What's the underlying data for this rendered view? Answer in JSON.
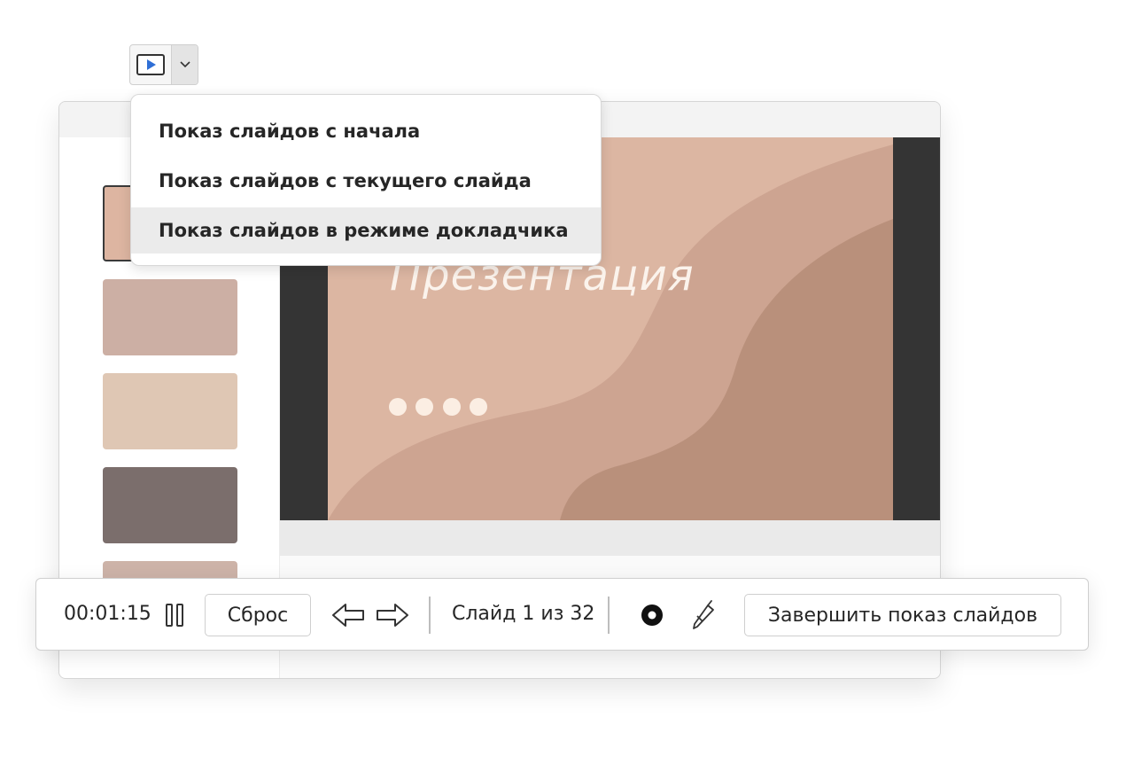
{
  "ribbon": {
    "slideshow_button": {
      "icon": "play-slideshow-icon",
      "dropdown_icon": "chevron-down-icon"
    }
  },
  "slideshow_menu": {
    "items": [
      {
        "label": "Показ слайдов с начала",
        "highlighted": false
      },
      {
        "label": "Показ слайдов с текущего слайда",
        "highlighted": false
      },
      {
        "label": "Показ слайдов в режиме докладчика",
        "highlighted": true
      }
    ]
  },
  "thumbnails": [
    {
      "color": "#ddb5a1",
      "selected": true
    },
    {
      "color": "#ccafa4",
      "selected": false
    },
    {
      "color": "#dfc7b4",
      "selected": false
    },
    {
      "color": "#7b6e6c",
      "selected": false
    },
    {
      "color": "#cdb3a8",
      "selected": false
    }
  ],
  "slide": {
    "title": "Презентация",
    "colors": {
      "background": "#dcb6a2",
      "wave_mid": "#cda491",
      "wave_dark": "#b9907b",
      "text": "#fbf3ec",
      "letterbox": "#343434"
    }
  },
  "toolbar": {
    "timer": "00:01:15",
    "pause_icon": "pause-icon",
    "reset_label": "Сброс",
    "prev_icon": "arrow-left-icon",
    "next_icon": "arrow-right-icon",
    "slide_counter": "Слайд 1 из 32",
    "laser_icon": "laser-pointer-icon",
    "pen_icon": "pen-icon",
    "end_label": "Завершить показ слайдов"
  }
}
